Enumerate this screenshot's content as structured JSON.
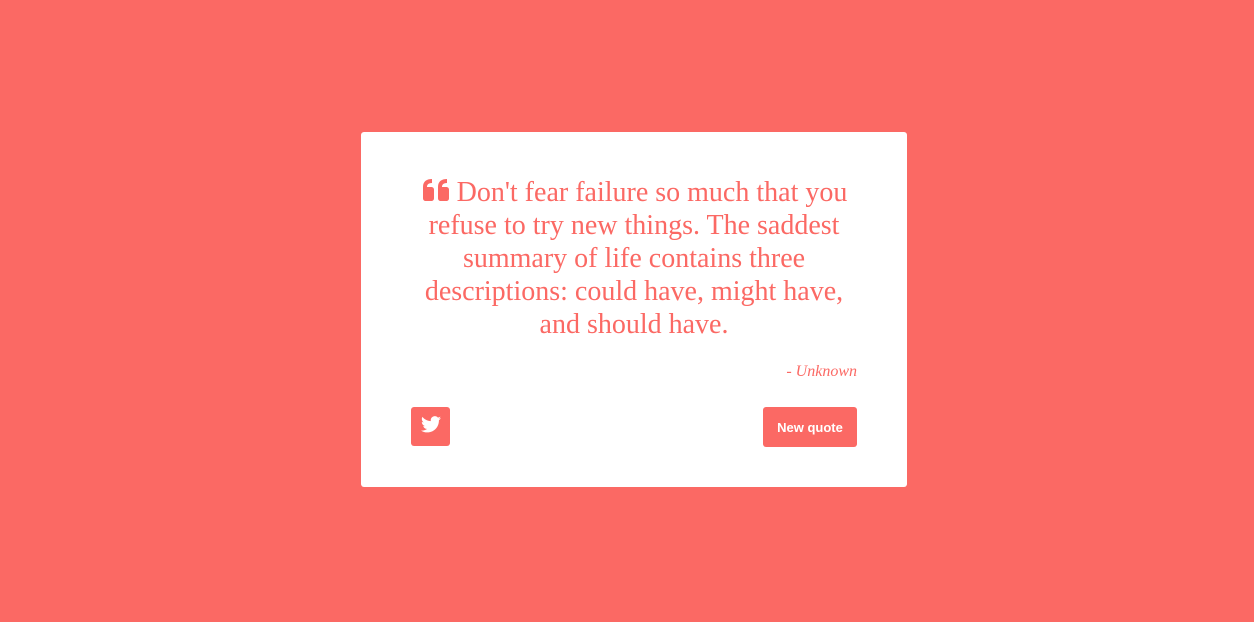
{
  "colors": {
    "accent": "#fb6964",
    "card_background": "#ffffff"
  },
  "quote": {
    "icon": "quote-left-icon",
    "text": "Don't fear failure so much that you refuse to try new things. The saddest summary of life contains three descriptions: could have, might have, and should have.",
    "author": "- Unknown"
  },
  "actions": {
    "tweet_icon": "twitter-icon",
    "new_quote_label": "New quote"
  }
}
